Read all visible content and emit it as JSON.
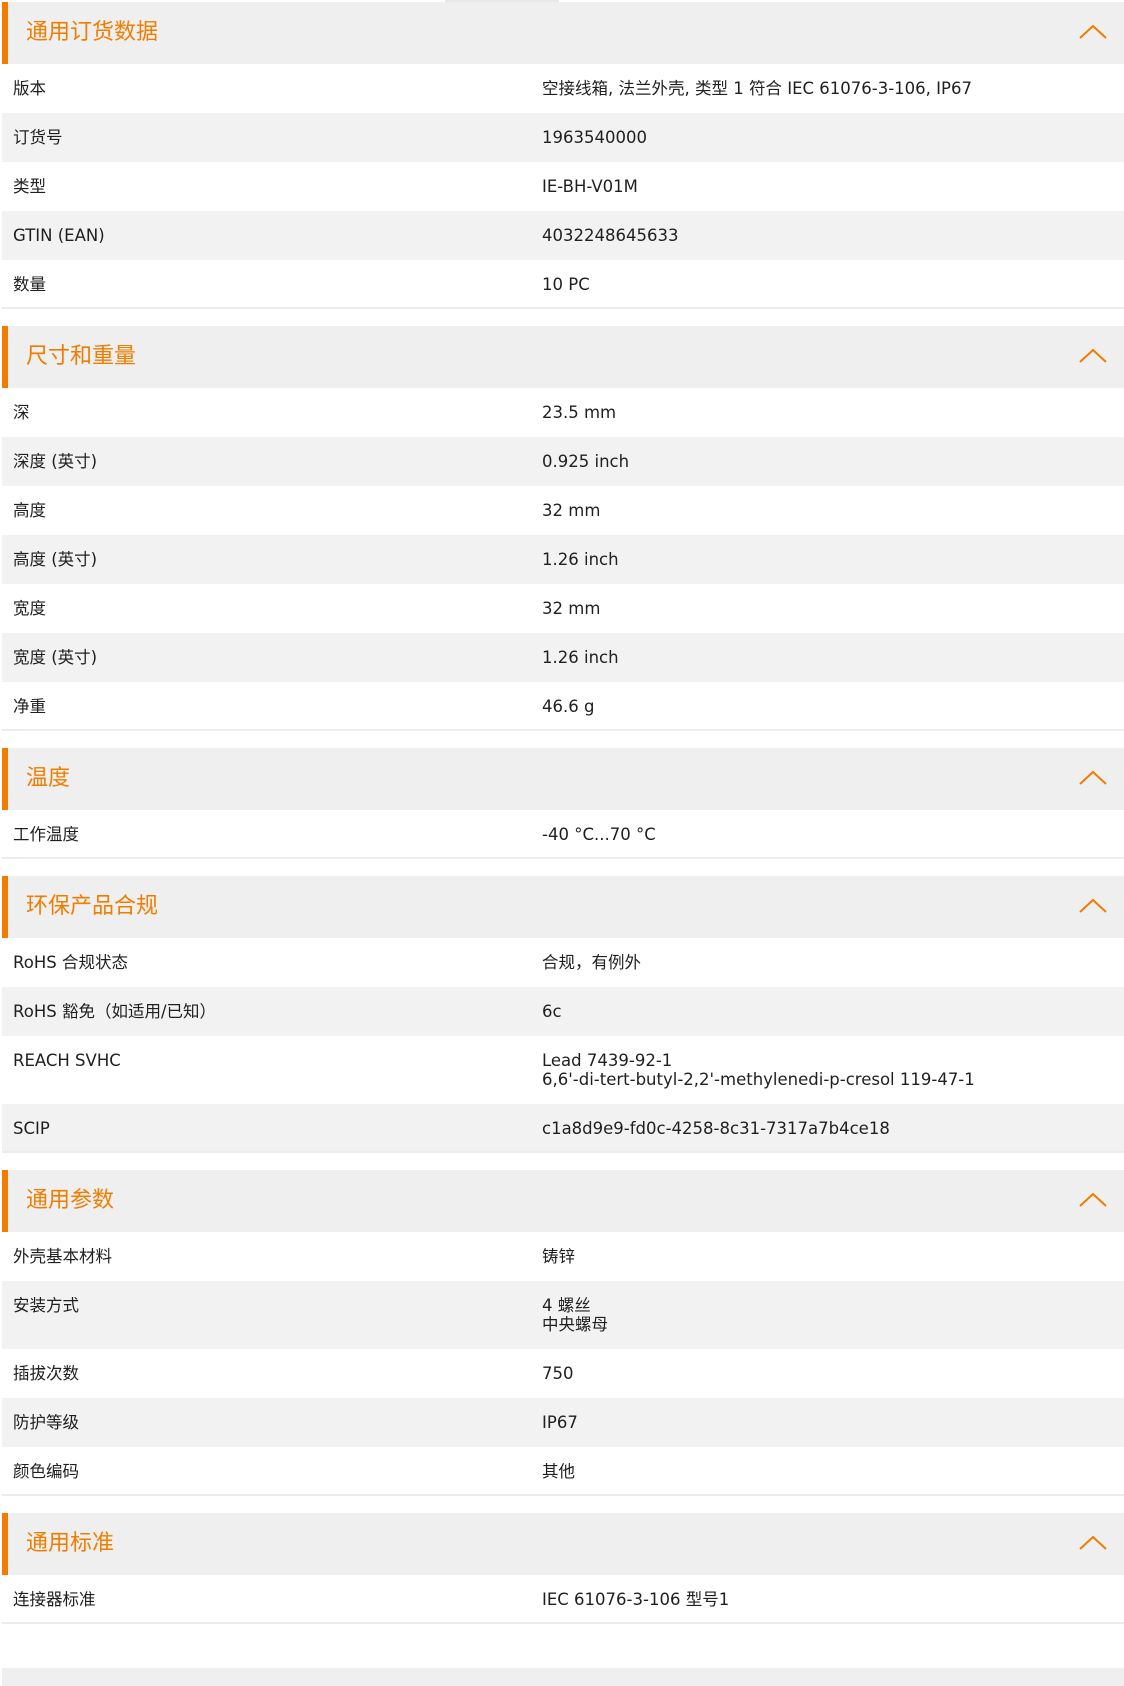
{
  "sections": [
    {
      "title": "通用订货数据",
      "rows": [
        {
          "label": "版本",
          "value": "空接线箱, 法兰外壳, 类型 1 符合 IEC 61076-3-106, IP67"
        },
        {
          "label": "订货号",
          "value": "1963540000"
        },
        {
          "label": "类型",
          "value": "IE-BH-V01M"
        },
        {
          "label": "GTIN (EAN)",
          "value": "4032248645633"
        },
        {
          "label": "数量",
          "value": "10  PC"
        }
      ]
    },
    {
      "title": "尺寸和重量",
      "rows": [
        {
          "label": "深",
          "value": "23.5  mm"
        },
        {
          "label": "深度 (英寸)",
          "value": "0.925  inch"
        },
        {
          "label": "高度",
          "value": "32  mm"
        },
        {
          "label": "高度 (英寸)",
          "value": "1.26  inch"
        },
        {
          "label": "宽度",
          "value": "32  mm"
        },
        {
          "label": "宽度 (英寸)",
          "value": "1.26  inch"
        },
        {
          "label": "净重",
          "value": "46.6  g"
        }
      ]
    },
    {
      "title": "温度",
      "rows": [
        {
          "label": "工作温度",
          "value": "-40 °C...70 °C"
        }
      ]
    },
    {
      "title": "环保产品合规",
      "rows": [
        {
          "label": "RoHS 合规状态",
          "value": "合规，有例外"
        },
        {
          "label": "RoHS 豁免（如适用/已知）",
          "value": "6c"
        },
        {
          "label": "REACH SVHC",
          "value": "Lead 7439-92-1\n6,6'-di-tert-butyl-2,2'-methylenedi-p-cresol 119-47-1"
        },
        {
          "label": "SCIP",
          "value": "c1a8d9e9-fd0c-4258-8c31-7317a7b4ce18"
        }
      ]
    },
    {
      "title": "通用参数",
      "rows": [
        {
          "label": "外壳基本材料",
          "value": "铸锌"
        },
        {
          "label": "安装方式",
          "value": "4 螺丝\n中央螺母"
        },
        {
          "label": "插拔次数",
          "value": "750"
        },
        {
          "label": "防护等级",
          "value": "IP67"
        },
        {
          "label": "颜色编码",
          "value": "其他"
        }
      ]
    },
    {
      "title": "通用标准",
      "rows": [
        {
          "label": "连接器标准",
          "value": "IEC 61076-3-106 型号1"
        }
      ]
    }
  ],
  "icons": {
    "collapse": "chevron-up-icon"
  },
  "colors": {
    "accent": "#f07d00",
    "header_bg": "#efefef",
    "row_alt_bg": "#f2f2f2"
  }
}
